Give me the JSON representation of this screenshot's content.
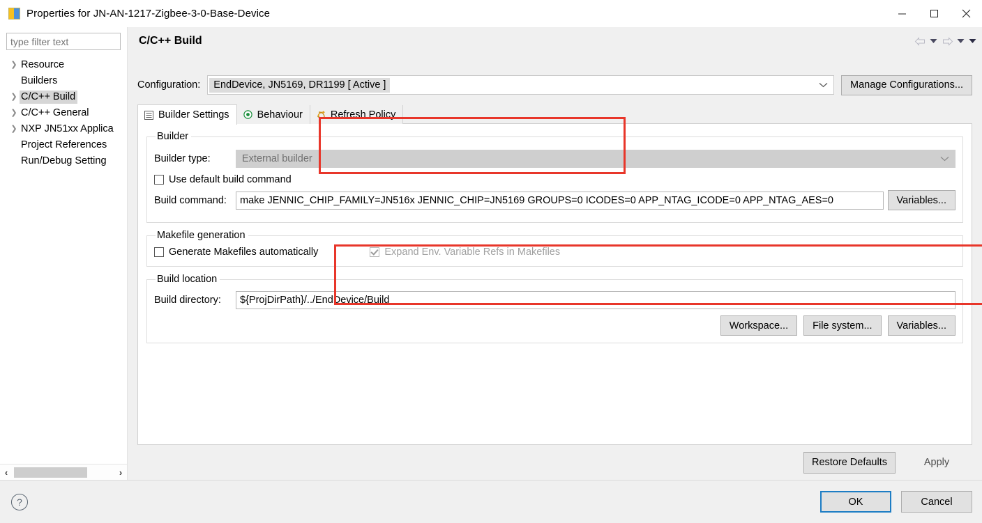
{
  "window": {
    "title": "Properties for JN-AN-1217-Zigbee-3-0-Base-Device",
    "icon": "properties-icon",
    "minimize": "–",
    "maximize": "□",
    "close": "✕"
  },
  "sidebar": {
    "filter_placeholder": "type filter text",
    "filter_value": "",
    "items": [
      {
        "label": "Resource",
        "expandable": true,
        "selected": false
      },
      {
        "label": "Builders",
        "expandable": false,
        "selected": false
      },
      {
        "label": "C/C++ Build",
        "expandable": true,
        "selected": true
      },
      {
        "label": "C/C++ General",
        "expandable": true,
        "selected": false
      },
      {
        "label": "NXP JN51xx Applica",
        "expandable": true,
        "selected": false
      },
      {
        "label": "Project References",
        "expandable": false,
        "selected": false
      },
      {
        "label": "Run/Debug Setting",
        "expandable": false,
        "selected": false
      }
    ],
    "scroll_left": "‹",
    "scroll_right": "›"
  },
  "page": {
    "title": "C/C++ Build",
    "nav": {
      "back": "back-arrow",
      "back_menu": "▾",
      "forward": "forward-arrow",
      "forward_menu": "▾",
      "view_menu": "▾"
    }
  },
  "configuration": {
    "label": "Configuration:",
    "value": "EndDevice, JN5169, DR1199  [ Active ]",
    "chevron": "⌄",
    "manage_button": "Manage Configurations..."
  },
  "tabs": [
    {
      "label": "Builder Settings",
      "icon": "list-icon",
      "active": true
    },
    {
      "label": "Behaviour",
      "icon": "target-icon",
      "active": false
    },
    {
      "label": "Refresh Policy",
      "icon": "refresh-policy-icon",
      "active": false
    }
  ],
  "builder_group": {
    "legend": "Builder",
    "builder_type_label": "Builder type:",
    "builder_type_value": "External builder",
    "use_default_label": "Use default build command",
    "use_default_checked": false,
    "build_command_label": "Build command:",
    "build_command_value": "make JENNIC_CHIP_FAMILY=JN516x JENNIC_CHIP=JN5169 GROUPS=0 ICODES=0 APP_NTAG_ICODE=0 APP_NTAG_AES=0",
    "variables_button": "Variables..."
  },
  "makefile_group": {
    "legend": "Makefile generation",
    "generate_label": "Generate Makefiles automatically",
    "generate_checked": false,
    "expand_label": "Expand Env. Variable Refs in Makefiles",
    "expand_checked": true,
    "expand_disabled": true
  },
  "build_location_group": {
    "legend": "Build location",
    "build_dir_label": "Build directory:",
    "build_dir_value": "${ProjDirPath}/../EndDevice/Build",
    "buttons": [
      "Workspace...",
      "File system...",
      "Variables..."
    ]
  },
  "panel_footer": {
    "restore_defaults": "Restore Defaults",
    "apply": "Apply"
  },
  "dialog_footer": {
    "help": "?",
    "ok": "OK",
    "cancel": "Cancel"
  },
  "annotations": {
    "color": "#e8362a",
    "boxes": [
      "configuration-highlight",
      "build-command-highlight"
    ]
  }
}
